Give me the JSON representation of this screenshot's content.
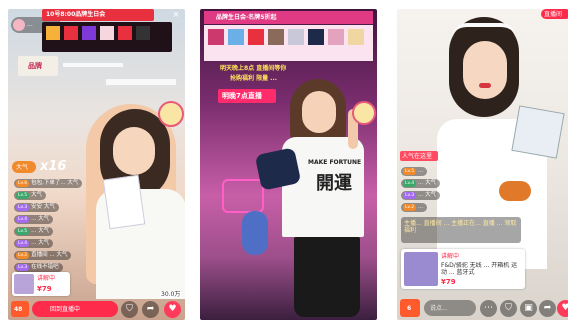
{
  "phone1": {
    "anchor_id": "...",
    "title_banner": "10号8:00品牌生日会",
    "brand_logo": "品牌",
    "big_number": "x16",
    "like_label": "大气",
    "chats": [
      {
        "badge": "Lv.6",
        "text": "包包,下单了... 大气"
      },
      {
        "badge": "Lv.5",
        "text": "大气"
      },
      {
        "badge": "Lv.3",
        "text": "安安 大气"
      },
      {
        "badge": "Lv.4",
        "text": "... 大气"
      },
      {
        "badge": "Lv.5",
        "text": "... 大气"
      },
      {
        "badge": "Lv.4",
        "text": "... 大气"
      },
      {
        "badge": "Lv.2",
        "text": "直播间 ... 大气"
      },
      {
        "badge": "Lv.3",
        "text": "在线不错吧"
      },
      {
        "badge": "Lv.1",
        "text": "... 大气"
      }
    ],
    "product_tag": "讲解中",
    "product_price": "¥79",
    "cart_count": "48",
    "bottom_label": "回到直播中",
    "like_count": "30.0万"
  },
  "phone2": {
    "title_banner": "品牌生日会·名牌5折起",
    "promo_line1": "明天晚上8点 直播间等你",
    "promo_line2": "抢购福利 限量 ...",
    "live_tag": "明晚7点直播",
    "shirt_text_top": "MAKE FORTUNE",
    "shirt_text_big": "開運"
  },
  "phone3": {
    "top_right": "直播间",
    "product_tag_top": "人气在这里",
    "chats": [
      {
        "badge": "Lv.5",
        "text": "..."
      },
      {
        "badge": "Lv.4",
        "text": "... 大气"
      },
      {
        "badge": "Lv.3",
        "text": "... 大气"
      },
      {
        "badge": "Lv.2",
        "text": "..."
      }
    ],
    "notice": "主播... 直播间 ... 主播正在... 直播 ... 领取福利",
    "product_tag": "讲解中",
    "product_title": "F&D/骆驼 无线 ... 开箱机 运动 ... 蓝牙式",
    "product_price": "¥79",
    "cart_count": "6",
    "input_placeholder": "说点..."
  },
  "colors": {
    "accent": "#ff2b4b",
    "purple_bg": "#3a1a5a",
    "pink_bg": "#c85fa8"
  }
}
